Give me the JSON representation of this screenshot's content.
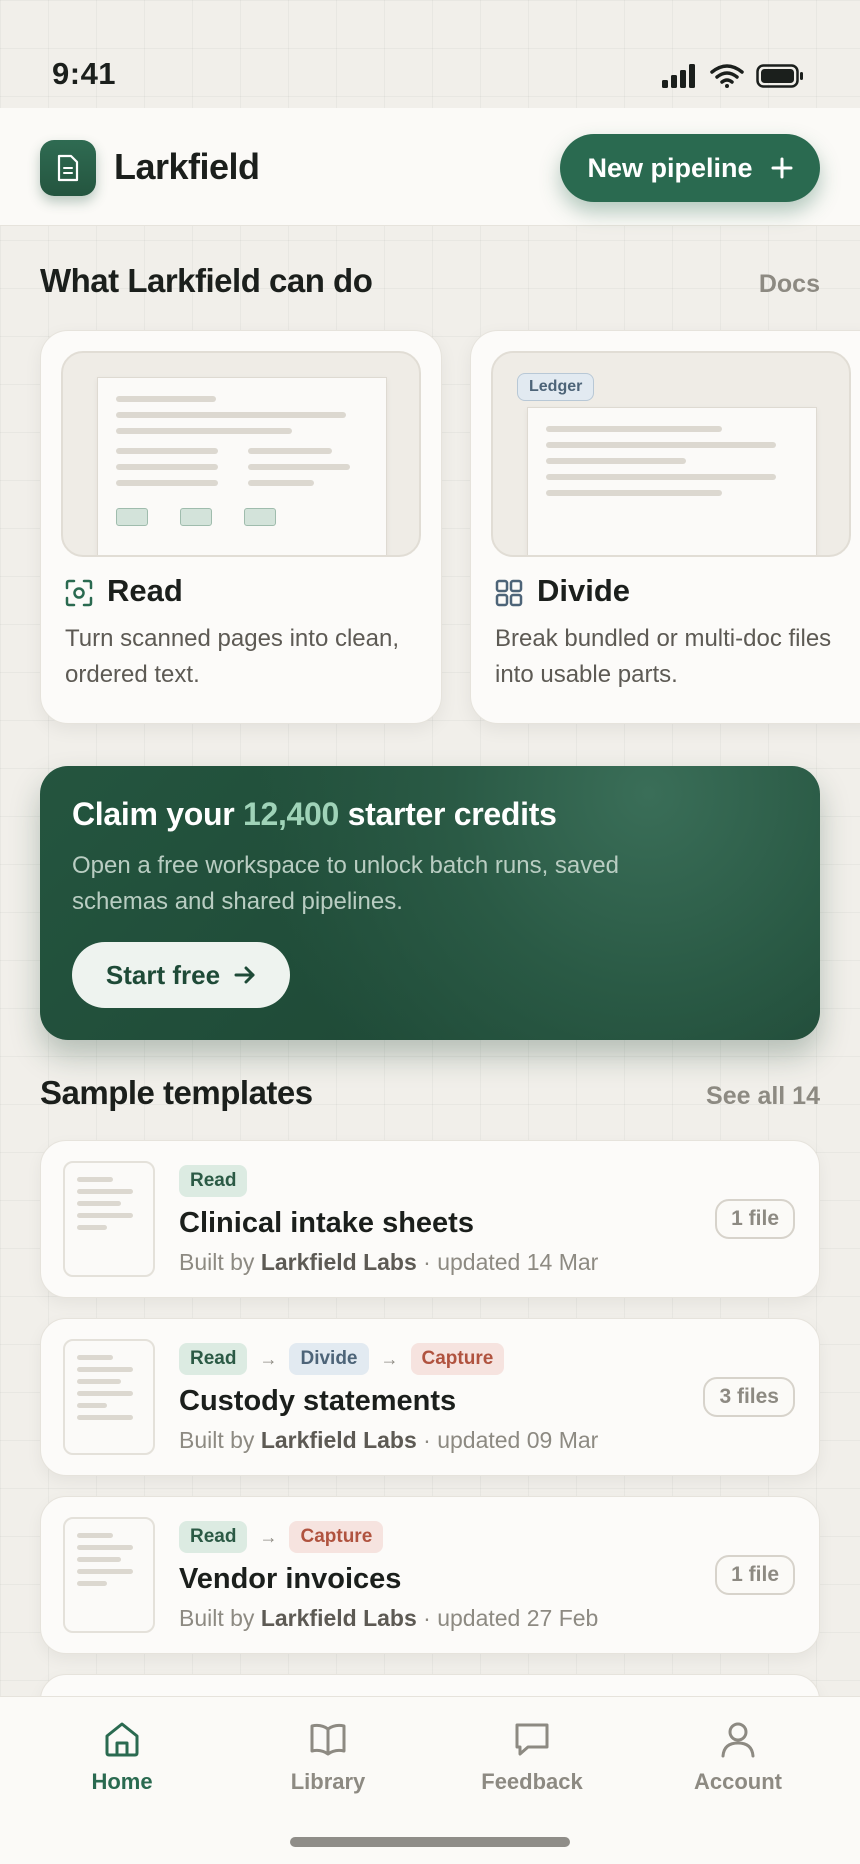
{
  "status": {
    "time": "9:41"
  },
  "header": {
    "brand": "Larkfield",
    "new_pipeline_label": "New pipeline"
  },
  "capabilities": {
    "title": "What Larkfield can do",
    "docs_link": "Docs",
    "cards": [
      {
        "title": "Read",
        "icon": "scan-icon",
        "desc": "Turn scanned pages into clean, ordered text."
      },
      {
        "title": "Divide",
        "icon": "grid-icon",
        "desc": "Break bundled or multi-doc files into usable parts.",
        "tag": "Ledger"
      }
    ]
  },
  "promo": {
    "title_pre": "Claim your ",
    "title_accent": "12,400",
    "title_post": " starter credits",
    "subtitle": "Open a free workspace to unlock batch runs, saved schemas and shared pipelines.",
    "cta": "Start free"
  },
  "templates": {
    "title": "Sample templates",
    "see_all": "See all 14",
    "items": [
      {
        "steps": [
          "Read"
        ],
        "title": "Clinical intake sheets",
        "built_by_prefix": "Built by ",
        "author": "Larkfield Labs",
        "updated": " · updated 14 Mar",
        "files": "1 file"
      },
      {
        "steps": [
          "Read",
          "Divide",
          "Capture"
        ],
        "title": "Custody statements",
        "built_by_prefix": "Built by ",
        "author": "Larkfield Labs",
        "updated": " · updated 09 Mar",
        "files": "3 files"
      },
      {
        "steps": [
          "Read",
          "Capture"
        ],
        "title": "Vendor invoices",
        "built_by_prefix": "Built by ",
        "author": "Larkfield Labs",
        "updated": " · updated 27 Feb",
        "files": "1 file"
      }
    ]
  },
  "tabbar": {
    "items": [
      {
        "label": "Home",
        "icon": "home-icon",
        "active": true
      },
      {
        "label": "Library",
        "icon": "book-icon",
        "active": false
      },
      {
        "label": "Feedback",
        "icon": "chat-icon",
        "active": false
      },
      {
        "label": "Account",
        "icon": "user-icon",
        "active": false
      }
    ]
  },
  "colors": {
    "accent": "#2a6a50",
    "read": "#2b5a45",
    "divide": "#4d6478",
    "capture": "#b0533f",
    "background": "#f1efea"
  }
}
